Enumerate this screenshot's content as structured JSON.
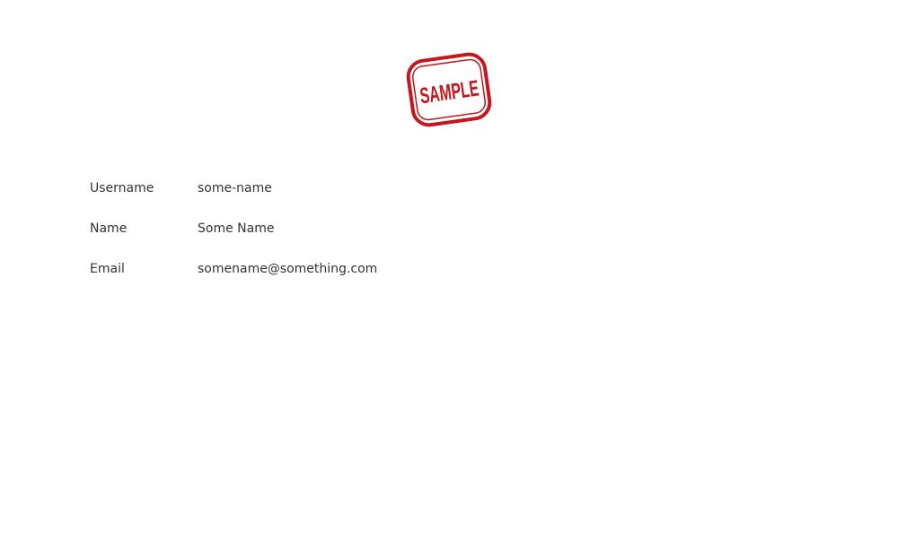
{
  "stamp": {
    "text": "SAMPLE",
    "color": "#c4161c",
    "icon": "sample-stamp-logo"
  },
  "profile": {
    "rows": [
      {
        "label": "Username",
        "value": "some-name"
      },
      {
        "label": "Name",
        "value": "Some Name"
      },
      {
        "label": "Email",
        "value": "somename@something.com"
      }
    ]
  }
}
